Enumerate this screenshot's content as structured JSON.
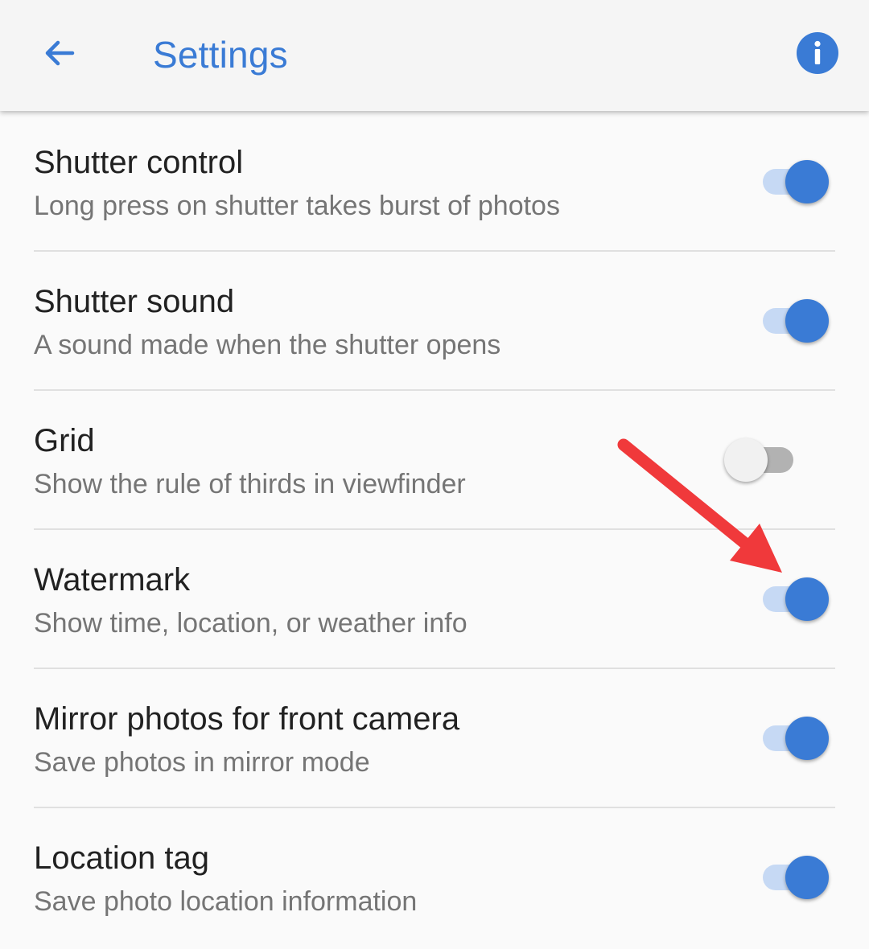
{
  "header": {
    "title": "Settings",
    "back_icon": "arrow-left-icon",
    "info_icon": "info-icon",
    "accent_color": "#3a7bd5"
  },
  "settings": [
    {
      "title": "Shutter control",
      "subtitle": "Long press on shutter takes burst of photos",
      "enabled": true
    },
    {
      "title": "Shutter sound",
      "subtitle": "A sound made when the shutter opens",
      "enabled": true
    },
    {
      "title": "Grid",
      "subtitle": "Show the rule of thirds in viewfinder",
      "enabled": false
    },
    {
      "title": "Watermark",
      "subtitle": "Show time, location, or weather info",
      "enabled": true
    },
    {
      "title": "Mirror photos for front camera",
      "subtitle": "Save photos in mirror mode",
      "enabled": true
    },
    {
      "title": "Location tag",
      "subtitle": "Save photo location information",
      "enabled": true
    }
  ],
  "annotation": {
    "icon": "red-arrow-icon",
    "color": "#f0393b"
  }
}
